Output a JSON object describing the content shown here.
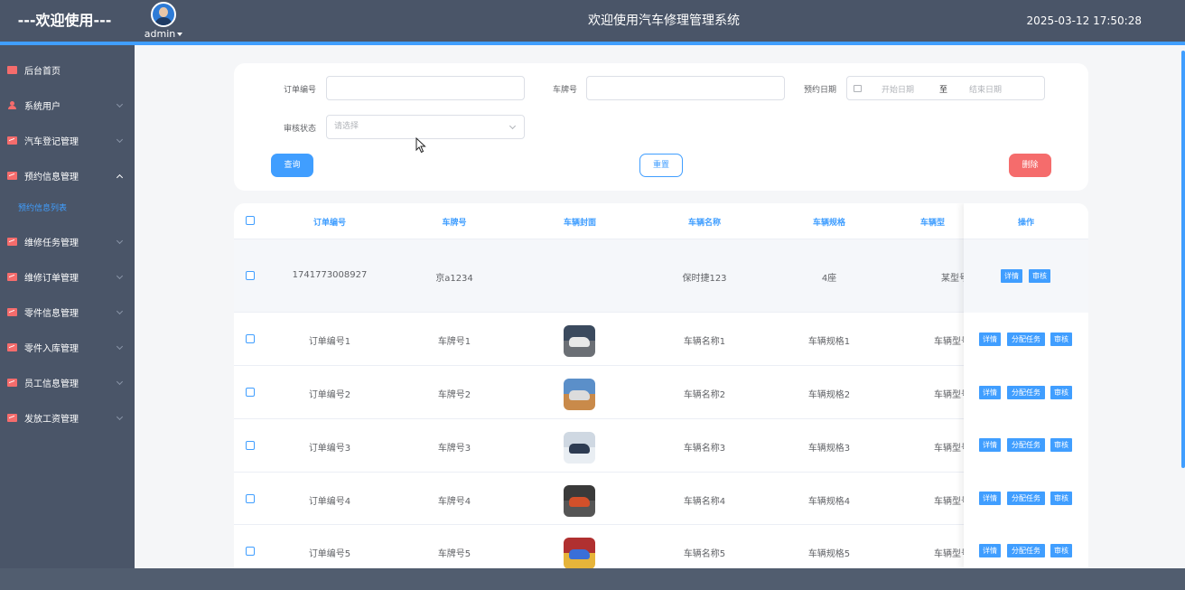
{
  "header": {
    "brand": "---欢迎使用---",
    "user": "admin",
    "title": "欢迎使用汽车修理管理系统",
    "datetime": "2025-03-12 17:50:28",
    "accent_color": "#409eff"
  },
  "sidebar": {
    "items": [
      {
        "label": "后台首页",
        "icon": "monitor-icon"
      },
      {
        "label": "系统用户",
        "icon": "user-icon"
      },
      {
        "label": "汽车登记管理",
        "icon": "chart-icon"
      },
      {
        "label": "预约信息管理",
        "icon": "chart-icon",
        "expanded": true
      },
      {
        "label": "维修任务管理",
        "icon": "chart-icon"
      },
      {
        "label": "维修订单管理",
        "icon": "chart-icon"
      },
      {
        "label": "零件信息管理",
        "icon": "chart-icon"
      },
      {
        "label": "零件入库管理",
        "icon": "chart-icon"
      },
      {
        "label": "员工信息管理",
        "icon": "chart-icon"
      },
      {
        "label": "发放工资管理",
        "icon": "chart-icon"
      }
    ],
    "subitem": "预约信息列表"
  },
  "search": {
    "order_no_label": "订单编号",
    "order_no_value": "",
    "plate_label": "车牌号",
    "plate_value": "",
    "date_label": "预约日期",
    "date_start_placeholder": "开始日期",
    "date_separator": "至",
    "date_end_placeholder": "结束日期",
    "audit_label": "审核状态",
    "audit_placeholder": "请选择",
    "query_button": "查询",
    "reset_button": "重置",
    "delete_button": "删除"
  },
  "table": {
    "columns": [
      "订单编号",
      "车牌号",
      "车辆封面",
      "车辆名称",
      "车辆规格",
      "车辆型",
      "操作"
    ],
    "rows": [
      {
        "order_no": "1741773008927",
        "plate": "京a1234",
        "cover": "",
        "name": "保时捷123",
        "spec": "4座",
        "model": "某型号",
        "actions": [
          "详情",
          "审核"
        ]
      },
      {
        "order_no": "订单编号1",
        "plate": "车牌号1",
        "cover": "car-photo-1",
        "name": "车辆名称1",
        "spec": "车辆规格1",
        "model": "车辆型号",
        "actions": [
          "详情",
          "分配任务",
          "审核"
        ]
      },
      {
        "order_no": "订单编号2",
        "plate": "车牌号2",
        "cover": "car-photo-2",
        "name": "车辆名称2",
        "spec": "车辆规格2",
        "model": "车辆型号",
        "actions": [
          "详情",
          "分配任务",
          "审核"
        ]
      },
      {
        "order_no": "订单编号3",
        "plate": "车牌号3",
        "cover": "car-photo-3",
        "name": "车辆名称3",
        "spec": "车辆规格3",
        "model": "车辆型号",
        "actions": [
          "详情",
          "分配任务",
          "审核"
        ]
      },
      {
        "order_no": "订单编号4",
        "plate": "车牌号4",
        "cover": "car-photo-4",
        "name": "车辆名称4",
        "spec": "车辆规格4",
        "model": "车辆型号",
        "actions": [
          "详情",
          "分配任务",
          "审核"
        ]
      },
      {
        "order_no": "订单编号5",
        "plate": "车牌号5",
        "cover": "car-photo-5",
        "name": "车辆名称5",
        "spec": "车辆规格5",
        "model": "车辆型号",
        "actions": [
          "详情",
          "分配任务",
          "审核"
        ]
      }
    ]
  }
}
